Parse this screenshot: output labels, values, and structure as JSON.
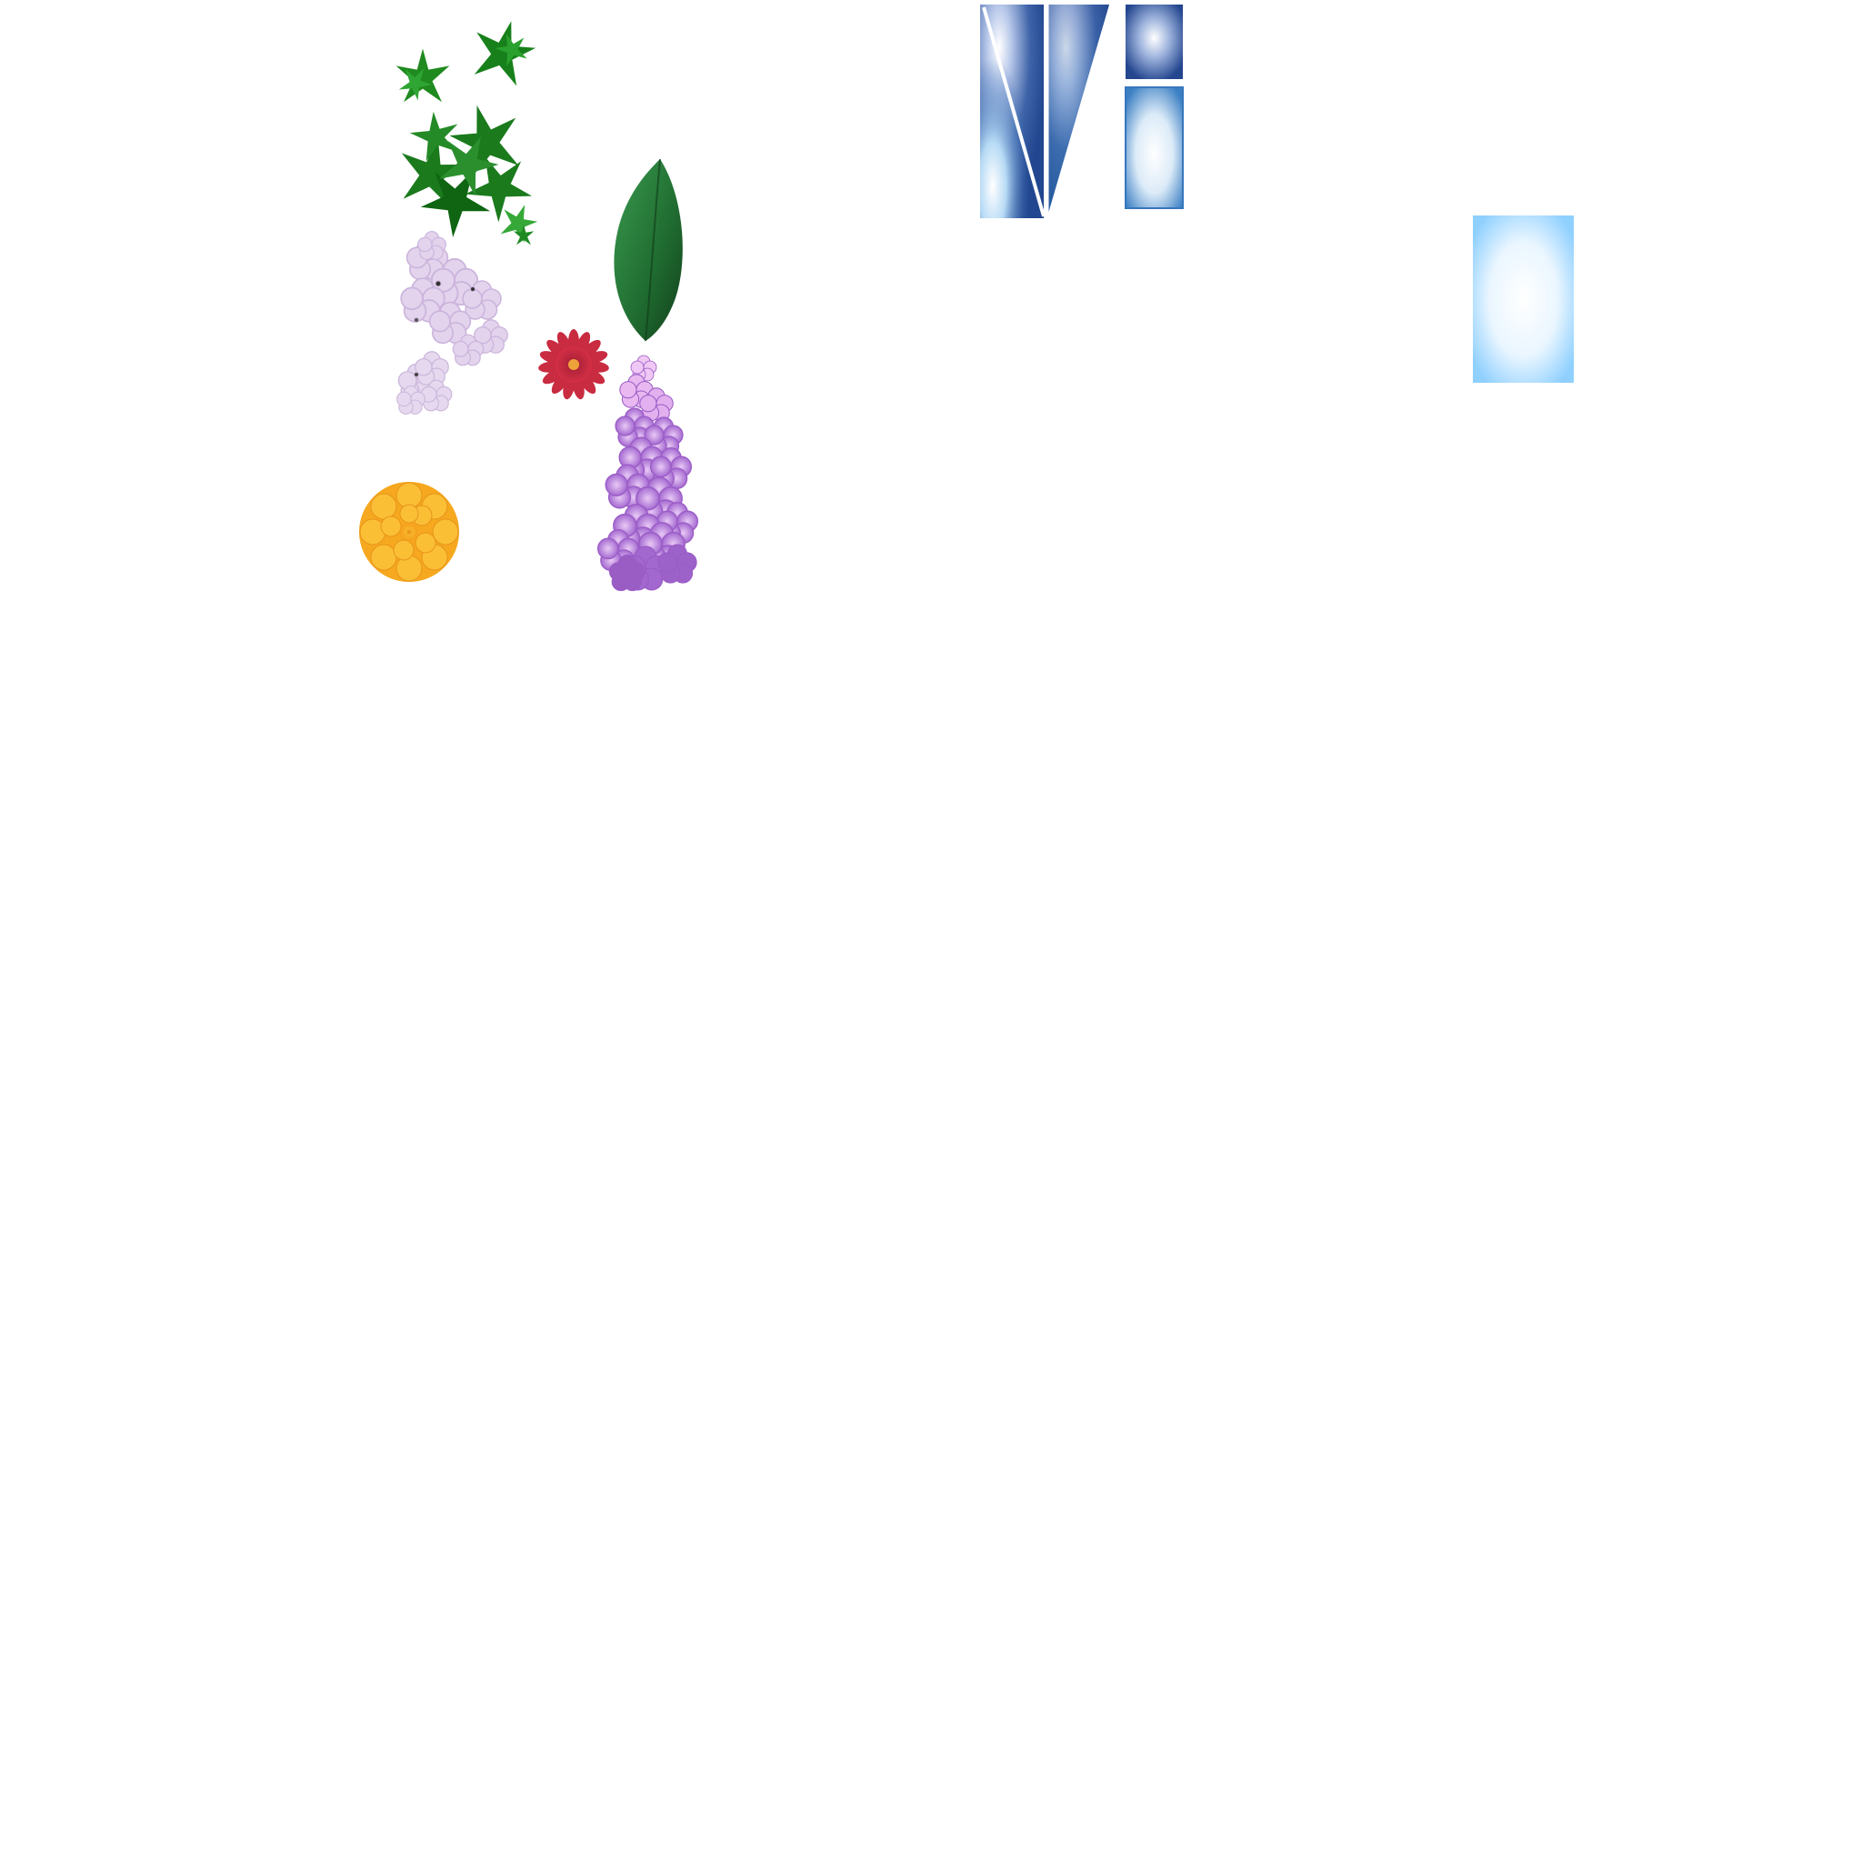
{
  "sprites": [
    {
      "name": "green-leaf-sprig-small-1",
      "kind": "leaf-sprig",
      "color": "#1f8a1f"
    },
    {
      "name": "green-leaf-sprig-small-2",
      "kind": "leaf-sprig",
      "color": "#1f8a1f"
    },
    {
      "name": "green-leaf-cluster-large",
      "kind": "leaf-cluster",
      "color": "#1d7a1d"
    },
    {
      "name": "green-leaf-sprig-tiny",
      "kind": "leaf-sprig",
      "color": "#33a033"
    },
    {
      "name": "dark-green-single-leaf",
      "kind": "single-leaf",
      "color": "#1f5e2c"
    },
    {
      "name": "pale-lilac-blossom-cluster-large",
      "kind": "blossom-cluster",
      "color": "#e2d2ec"
    },
    {
      "name": "pale-lilac-blossom-cluster-small",
      "kind": "blossom-cluster",
      "color": "#e6d9ef"
    },
    {
      "name": "red-daisy-flower",
      "kind": "daisy",
      "color": "#c0283a"
    },
    {
      "name": "purple-lilac-spike",
      "kind": "lilac-spike",
      "color": "#b07ad9"
    },
    {
      "name": "orange-marigold-flower",
      "kind": "marigold",
      "color": "#f5a623"
    },
    {
      "name": "blue-glass-triangle-left",
      "kind": "glass-panel",
      "color": "#2d5fa8"
    },
    {
      "name": "blue-glass-triangle-right",
      "kind": "glass-panel",
      "color": "#2f6db3"
    },
    {
      "name": "blue-glass-square-small",
      "kind": "glass-panel",
      "color": "#2c4f95"
    },
    {
      "name": "blue-glass-rect-tall",
      "kind": "glass-panel",
      "color": "#3b7fc4"
    },
    {
      "name": "light-blue-glow-rect",
      "kind": "glow-panel",
      "color": "#8fd0ff"
    }
  ]
}
